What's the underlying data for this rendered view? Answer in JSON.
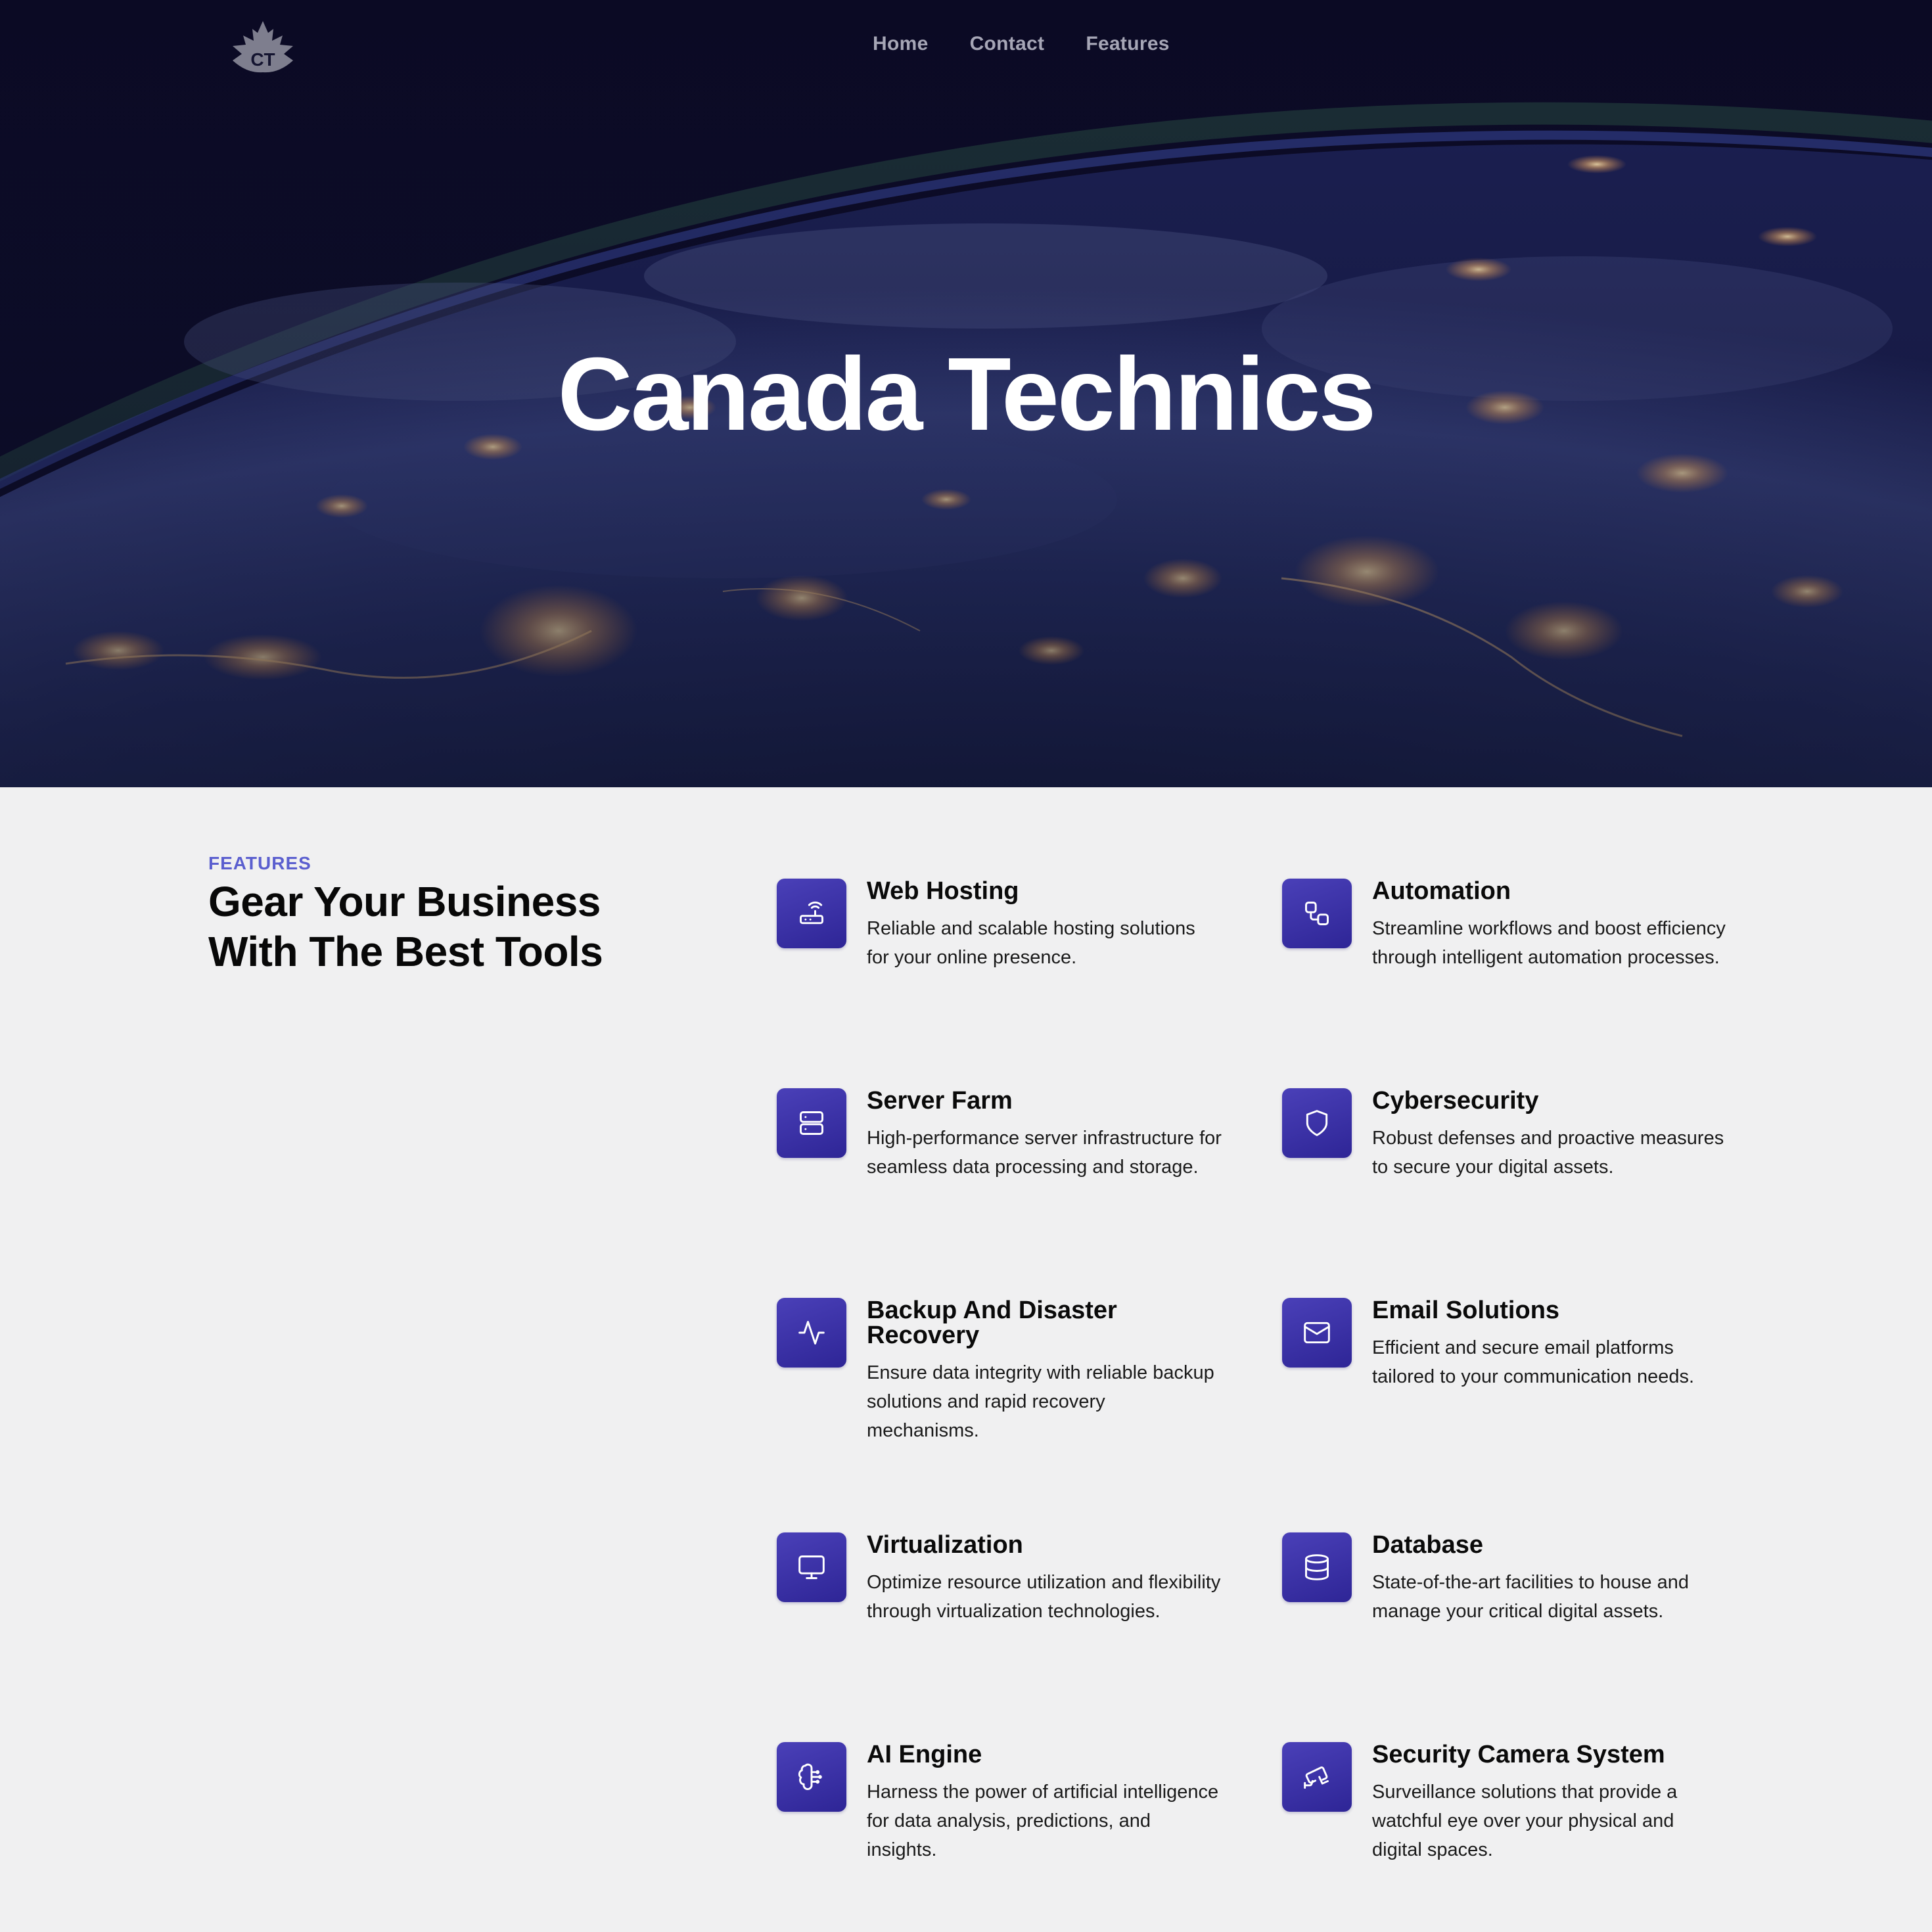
{
  "header": {
    "logo_text": "CT",
    "nav": [
      {
        "label": "Home"
      },
      {
        "label": "Contact"
      },
      {
        "label": "Features"
      }
    ]
  },
  "hero": {
    "title": "Canada Technics"
  },
  "features": {
    "eyebrow": "FEATURES",
    "heading_line1": "Gear Your Business",
    "heading_line2": "With The Best Tools",
    "items": [
      {
        "title": "Web Hosting",
        "description": "Reliable and scalable hosting solutions for your online presence.",
        "icon": "router-icon"
      },
      {
        "title": "Automation",
        "description": "Streamline workflows and boost efficiency through intelligent automation processes.",
        "icon": "workflow-icon"
      },
      {
        "title": "Server Farm",
        "description": "High-performance server infrastructure for seamless data processing and storage.",
        "icon": "server-icon"
      },
      {
        "title": "Cybersecurity",
        "description": "Robust defenses and proactive measures to secure your digital assets.",
        "icon": "shield-icon"
      },
      {
        "title": "Backup And Disaster Recovery",
        "description": "Ensure data integrity with reliable backup solutions and rapid recovery mechanisms.",
        "icon": "activity-icon"
      },
      {
        "title": "Email Solutions",
        "description": "Efficient and secure email platforms tailored to your communication needs.",
        "icon": "mail-icon"
      },
      {
        "title": "Virtualization",
        "description": "Optimize resource utilization and flexibility through virtualization technologies.",
        "icon": "monitor-icon"
      },
      {
        "title": "Database",
        "description": "State-of-the-art facilities to house and manage your critical digital assets.",
        "icon": "database-icon"
      },
      {
        "title": "AI Engine",
        "description": "Harness the power of artificial intelligence for data analysis, predictions, and insights.",
        "icon": "brain-circuit-icon"
      },
      {
        "title": "Security Camera System",
        "description": "Surveillance solutions that provide a watchful eye over your physical and digital spaces.",
        "icon": "cctv-icon"
      }
    ]
  },
  "colors": {
    "accent": "#5b5fcf",
    "icon_bg": "#3b31a8",
    "hero_bg": "#0c0a26",
    "page_bg": "#f0f0f1"
  }
}
